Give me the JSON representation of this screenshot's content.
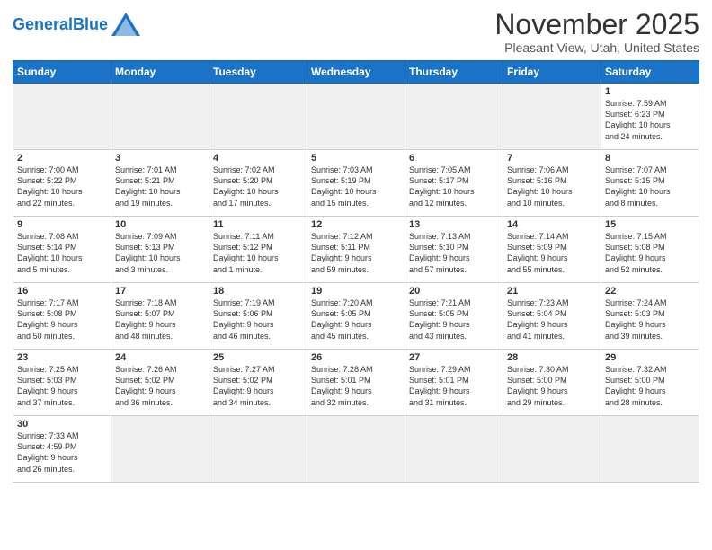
{
  "logo": {
    "text_general": "General",
    "text_blue": "Blue"
  },
  "title": "November 2025",
  "subtitle": "Pleasant View, Utah, United States",
  "days_of_week": [
    "Sunday",
    "Monday",
    "Tuesday",
    "Wednesday",
    "Thursday",
    "Friday",
    "Saturday"
  ],
  "weeks": [
    [
      {
        "day": "",
        "info": "",
        "empty": true
      },
      {
        "day": "",
        "info": "",
        "empty": true
      },
      {
        "day": "",
        "info": "",
        "empty": true
      },
      {
        "day": "",
        "info": "",
        "empty": true
      },
      {
        "day": "",
        "info": "",
        "empty": true
      },
      {
        "day": "",
        "info": "",
        "empty": true
      },
      {
        "day": "1",
        "info": "Sunrise: 7:59 AM\nSunset: 6:23 PM\nDaylight: 10 hours\nand 24 minutes."
      }
    ],
    [
      {
        "day": "2",
        "info": "Sunrise: 7:00 AM\nSunset: 5:22 PM\nDaylight: 10 hours\nand 22 minutes."
      },
      {
        "day": "3",
        "info": "Sunrise: 7:01 AM\nSunset: 5:21 PM\nDaylight: 10 hours\nand 19 minutes."
      },
      {
        "day": "4",
        "info": "Sunrise: 7:02 AM\nSunset: 5:20 PM\nDaylight: 10 hours\nand 17 minutes."
      },
      {
        "day": "5",
        "info": "Sunrise: 7:03 AM\nSunset: 5:19 PM\nDaylight: 10 hours\nand 15 minutes."
      },
      {
        "day": "6",
        "info": "Sunrise: 7:05 AM\nSunset: 5:17 PM\nDaylight: 10 hours\nand 12 minutes."
      },
      {
        "day": "7",
        "info": "Sunrise: 7:06 AM\nSunset: 5:16 PM\nDaylight: 10 hours\nand 10 minutes."
      },
      {
        "day": "8",
        "info": "Sunrise: 7:07 AM\nSunset: 5:15 PM\nDaylight: 10 hours\nand 8 minutes."
      }
    ],
    [
      {
        "day": "9",
        "info": "Sunrise: 7:08 AM\nSunset: 5:14 PM\nDaylight: 10 hours\nand 5 minutes."
      },
      {
        "day": "10",
        "info": "Sunrise: 7:09 AM\nSunset: 5:13 PM\nDaylight: 10 hours\nand 3 minutes."
      },
      {
        "day": "11",
        "info": "Sunrise: 7:11 AM\nSunset: 5:12 PM\nDaylight: 10 hours\nand 1 minute."
      },
      {
        "day": "12",
        "info": "Sunrise: 7:12 AM\nSunset: 5:11 PM\nDaylight: 9 hours\nand 59 minutes."
      },
      {
        "day": "13",
        "info": "Sunrise: 7:13 AM\nSunset: 5:10 PM\nDaylight: 9 hours\nand 57 minutes."
      },
      {
        "day": "14",
        "info": "Sunrise: 7:14 AM\nSunset: 5:09 PM\nDaylight: 9 hours\nand 55 minutes."
      },
      {
        "day": "15",
        "info": "Sunrise: 7:15 AM\nSunset: 5:08 PM\nDaylight: 9 hours\nand 52 minutes."
      }
    ],
    [
      {
        "day": "16",
        "info": "Sunrise: 7:17 AM\nSunset: 5:08 PM\nDaylight: 9 hours\nand 50 minutes."
      },
      {
        "day": "17",
        "info": "Sunrise: 7:18 AM\nSunset: 5:07 PM\nDaylight: 9 hours\nand 48 minutes."
      },
      {
        "day": "18",
        "info": "Sunrise: 7:19 AM\nSunset: 5:06 PM\nDaylight: 9 hours\nand 46 minutes."
      },
      {
        "day": "19",
        "info": "Sunrise: 7:20 AM\nSunset: 5:05 PM\nDaylight: 9 hours\nand 45 minutes."
      },
      {
        "day": "20",
        "info": "Sunrise: 7:21 AM\nSunset: 5:05 PM\nDaylight: 9 hours\nand 43 minutes."
      },
      {
        "day": "21",
        "info": "Sunrise: 7:23 AM\nSunset: 5:04 PM\nDaylight: 9 hours\nand 41 minutes."
      },
      {
        "day": "22",
        "info": "Sunrise: 7:24 AM\nSunset: 5:03 PM\nDaylight: 9 hours\nand 39 minutes."
      }
    ],
    [
      {
        "day": "23",
        "info": "Sunrise: 7:25 AM\nSunset: 5:03 PM\nDaylight: 9 hours\nand 37 minutes."
      },
      {
        "day": "24",
        "info": "Sunrise: 7:26 AM\nSunset: 5:02 PM\nDaylight: 9 hours\nand 36 minutes."
      },
      {
        "day": "25",
        "info": "Sunrise: 7:27 AM\nSunset: 5:02 PM\nDaylight: 9 hours\nand 34 minutes."
      },
      {
        "day": "26",
        "info": "Sunrise: 7:28 AM\nSunset: 5:01 PM\nDaylight: 9 hours\nand 32 minutes."
      },
      {
        "day": "27",
        "info": "Sunrise: 7:29 AM\nSunset: 5:01 PM\nDaylight: 9 hours\nand 31 minutes."
      },
      {
        "day": "28",
        "info": "Sunrise: 7:30 AM\nSunset: 5:00 PM\nDaylight: 9 hours\nand 29 minutes."
      },
      {
        "day": "29",
        "info": "Sunrise: 7:32 AM\nSunset: 5:00 PM\nDaylight: 9 hours\nand 28 minutes."
      }
    ],
    [
      {
        "day": "30",
        "info": "Sunrise: 7:33 AM\nSunset: 4:59 PM\nDaylight: 9 hours\nand 26 minutes."
      },
      {
        "day": "",
        "info": "",
        "empty": true
      },
      {
        "day": "",
        "info": "",
        "empty": true
      },
      {
        "day": "",
        "info": "",
        "empty": true
      },
      {
        "day": "",
        "info": "",
        "empty": true
      },
      {
        "day": "",
        "info": "",
        "empty": true
      },
      {
        "day": "",
        "info": "",
        "empty": true
      }
    ]
  ]
}
